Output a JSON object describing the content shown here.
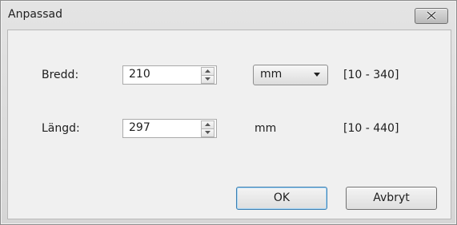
{
  "window": {
    "title": "Anpassad"
  },
  "width_row": {
    "label": "Bredd:",
    "value": "210",
    "unit": "mm",
    "range": "[10 - 340]"
  },
  "length_row": {
    "label": "Längd:",
    "value": "297",
    "unit": "mm",
    "range": "[10 - 440]"
  },
  "buttons": {
    "ok": "OK",
    "cancel": "Avbryt"
  },
  "icons": {
    "close": "close-icon",
    "spin_up": "spin-up-icon",
    "spin_down": "spin-down-icon",
    "dropdown": "chevron-down-icon"
  }
}
